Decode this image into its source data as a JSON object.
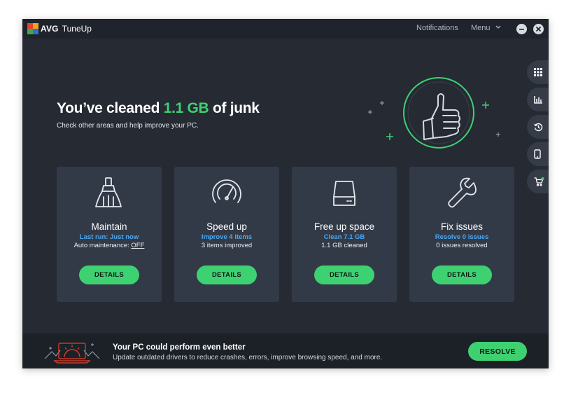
{
  "app": {
    "brand": "AVG",
    "product": "TuneUp",
    "notifications_label": "Notifications",
    "menu_label": "Menu"
  },
  "hero": {
    "title_prefix": "You’ve cleaned ",
    "title_amount": "1.1 GB",
    "title_suffix": " of junk",
    "subtitle": "Check other areas and help improve your PC."
  },
  "side_rail": [
    {
      "icon": "apps-grid-icon"
    },
    {
      "icon": "bar-chart-icon"
    },
    {
      "icon": "history-icon"
    },
    {
      "icon": "mobile-icon"
    },
    {
      "icon": "cart-icon"
    }
  ],
  "cards": [
    {
      "icon": "broom-icon",
      "title": "Maintain",
      "link": "Last run: Just now",
      "stat_prefix": "Auto maintenance: ",
      "stat_value": "OFF",
      "button": "DETAILS"
    },
    {
      "icon": "speedometer-icon",
      "title": "Speed up",
      "link": "Improve 4 items",
      "stat": "3 items improved",
      "button": "DETAILS"
    },
    {
      "icon": "hard-drive-icon",
      "title": "Free up space",
      "link": "Clean 7.1 GB",
      "stat": "1.1 GB cleaned",
      "button": "DETAILS"
    },
    {
      "icon": "wrench-icon",
      "title": "Fix issues",
      "link": "Resolve 0 issues",
      "stat": "0 issues resolved",
      "button": "DETAILS"
    }
  ],
  "banner": {
    "title": "Your PC could perform even better",
    "subtitle": "Update outdated drivers to reduce crashes, errors, improve browsing speed, and more.",
    "button": "RESOLVE"
  },
  "colors": {
    "accent_green": "#3ed172",
    "link_blue": "#4aa7f2",
    "background": "#252a33",
    "card": "#333a47"
  }
}
